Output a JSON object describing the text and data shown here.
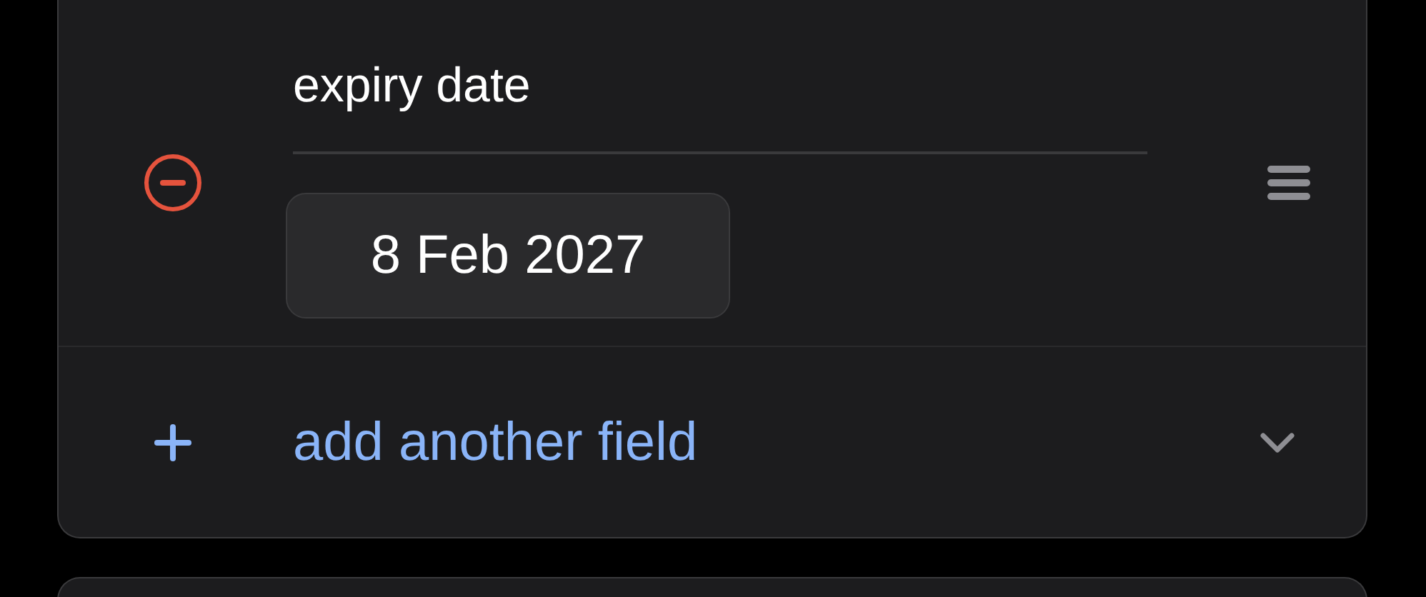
{
  "field": {
    "label": "expiry date",
    "value": "8 Feb 2027"
  },
  "add_row": {
    "label": "add another field"
  }
}
